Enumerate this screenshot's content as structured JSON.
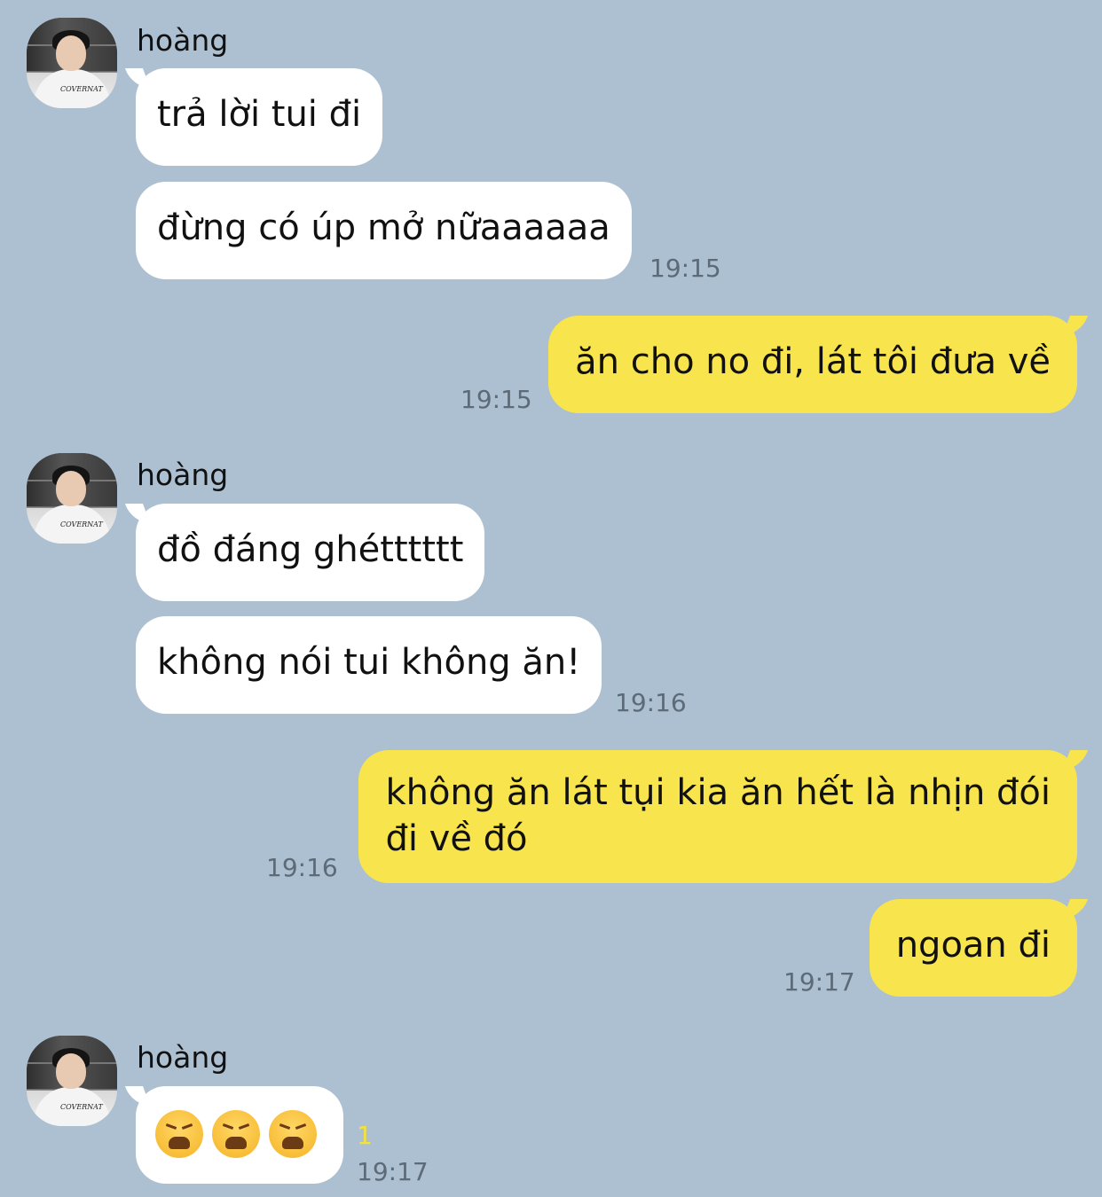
{
  "chat": {
    "sender_name": "hoàng",
    "messages": [
      {
        "text": "trả lời tui đi"
      },
      {
        "text": "đừng có úp mở nữaaaaaa",
        "time": "19:15"
      },
      {
        "text": "ăn cho no đi, lát tôi đưa về",
        "time": "19:15"
      },
      {
        "text": "đồ đáng ghétttttt"
      },
      {
        "text": "không nói tui không ăn!",
        "time": "19:16"
      },
      {
        "text_line1": "không ăn lát tụi kia ăn hết là nhịn đói",
        "text_line2": "đi về đó",
        "time": "19:16"
      },
      {
        "text": "ngoan đi",
        "time": "19:17"
      },
      {
        "emoji_name": "weary-face-emoji",
        "emoji_count": 3,
        "unread": "1",
        "time": "19:17"
      }
    ]
  },
  "colors": {
    "background": "#adc0d1",
    "incoming_bubble": "#ffffff",
    "outgoing_bubble": "#f8e44c",
    "timestamp": "#5d6a77",
    "unread_indicator": "#f4e23a"
  }
}
